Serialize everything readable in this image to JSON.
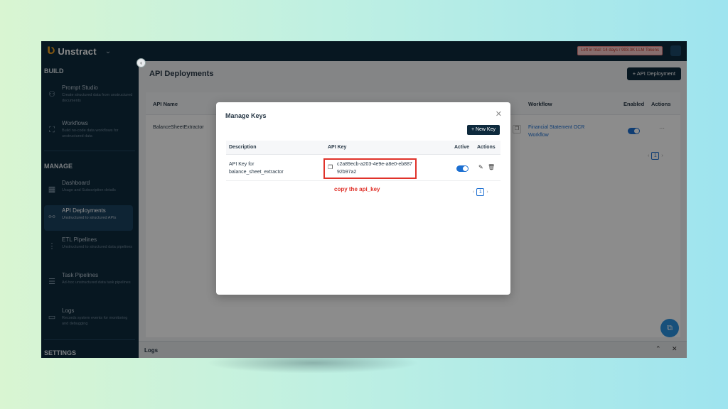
{
  "app": {
    "brand": "Unstract",
    "trial_notice": "Left in trial: 14 days / 993.3K LLM Tokens"
  },
  "sidebar": {
    "sections": {
      "build": "BUILD",
      "manage": "MANAGE",
      "settings": "SETTINGS"
    },
    "items": [
      {
        "title": "Prompt Studio",
        "desc": "Create structured data from unstructured documents",
        "icon": "prompt-studio-icon"
      },
      {
        "title": "Workflows",
        "desc": "Build no-code data workflows for unstructured data",
        "icon": "workflows-icon"
      },
      {
        "title": "Dashboard",
        "desc": "Usage and Subscription details",
        "icon": "dashboard-icon"
      },
      {
        "title": "API Deployments",
        "desc": "Unstructured to structured APIs",
        "icon": "api-deployments-icon",
        "active": true
      },
      {
        "title": "ETL Pipelines",
        "desc": "Unstructured to structured data pipelines",
        "icon": "etl-pipelines-icon"
      },
      {
        "title": "Task Pipelines",
        "desc": "Ad-hoc unstructured data task pipelines",
        "icon": "task-pipelines-icon"
      },
      {
        "title": "Logs",
        "desc": "Records system events for monitoring and debugging",
        "icon": "logs-icon"
      }
    ]
  },
  "main": {
    "title": "API Deployments",
    "new_deployment": "+ API Deployment",
    "columns": {
      "api_name": "API Name",
      "workflow": "Workflow",
      "enabled": "Enabled",
      "actions": "Actions"
    },
    "row": {
      "api_name": "BalanceSheetExtractor",
      "workflow": "Financial Statement OCR Workflow",
      "enabled": true
    },
    "page": "1",
    "logs": "Logs"
  },
  "modal": {
    "title": "Manage Keys",
    "new_key": "+ New Key",
    "columns": {
      "description": "Description",
      "api_key": "API Key",
      "active": "Active",
      "actions": "Actions"
    },
    "row": {
      "description": "API Key for balance_sheet_extractor",
      "api_key": "c2a89ecb-a203-4e9e-a8e0-eb88792b97a2",
      "active": true
    },
    "page": "1",
    "annotation": "copy the api_key"
  },
  "colors": {
    "sidebar": "#0e2a3d",
    "accent": "#1c6fd1",
    "highlight": "#e0322a"
  }
}
